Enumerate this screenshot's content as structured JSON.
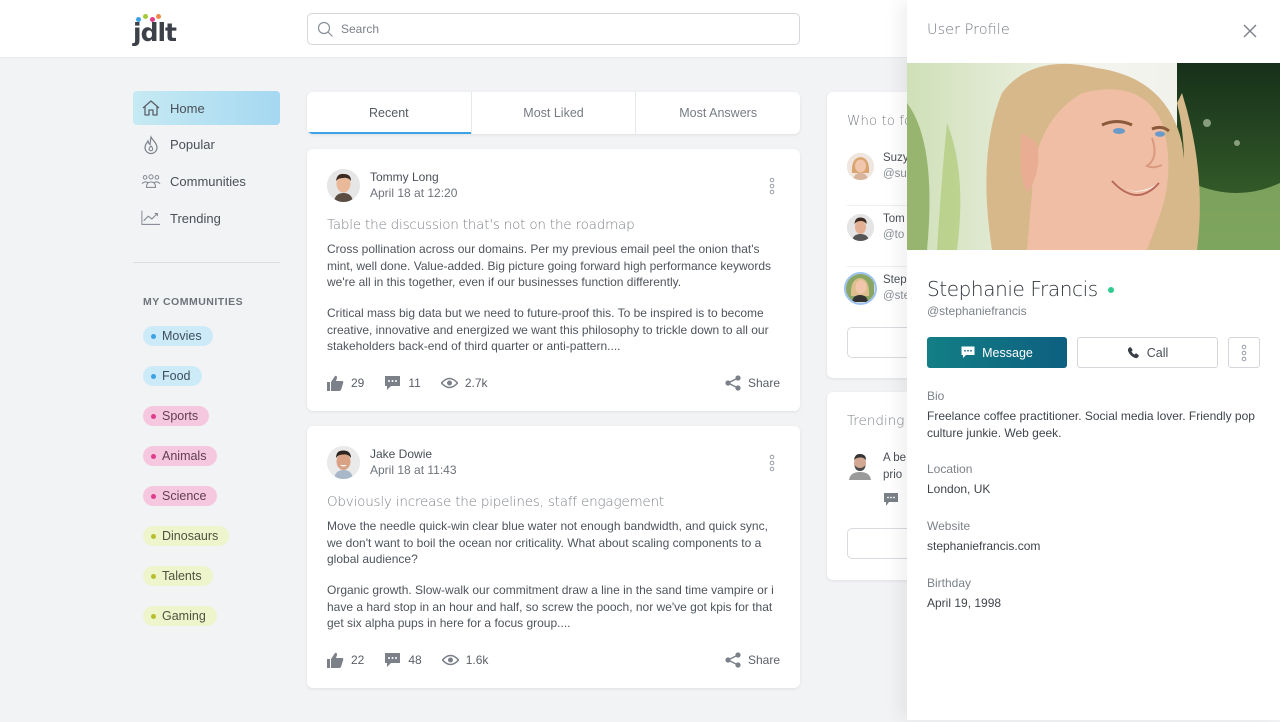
{
  "app": {
    "logo_text": "jdlt",
    "logo_dots": [
      "#3ba3e3",
      "#e23b8a",
      "#a6c93a",
      "#f08a4b"
    ]
  },
  "search": {
    "placeholder": "Search",
    "value": ""
  },
  "nav": {
    "items": [
      {
        "label": "Home",
        "icon": "home-icon",
        "active": true
      },
      {
        "label": "Popular",
        "icon": "flame-icon",
        "active": false
      },
      {
        "label": "Communities",
        "icon": "people-icon",
        "active": false
      },
      {
        "label": "Trending",
        "icon": "trending-chart-icon",
        "active": false
      }
    ]
  },
  "communities": {
    "title": "MY COMMUNITIES",
    "items": [
      {
        "label": "Movies",
        "bg": "#cdeaf8",
        "dot": "#3ba3e3",
        "fg": "#3f4e5e"
      },
      {
        "label": "Food",
        "bg": "#cdeaf8",
        "dot": "#3ba3e3",
        "fg": "#3f4e5e"
      },
      {
        "label": "Sports",
        "bg": "#f6c8e0",
        "dot": "#e23b8a",
        "fg": "#5e3f50"
      },
      {
        "label": "Animals",
        "bg": "#f6c8e0",
        "dot": "#e23b8a",
        "fg": "#5e3f50"
      },
      {
        "label": "Science",
        "bg": "#f6c8e0",
        "dot": "#e23b8a",
        "fg": "#5e3f50"
      },
      {
        "label": "Dinosaurs",
        "bg": "#eef4cc",
        "dot": "#b7bf2c",
        "fg": "#4f5240"
      },
      {
        "label": "Talents",
        "bg": "#eef4cc",
        "dot": "#b7bf2c",
        "fg": "#4f5240"
      },
      {
        "label": "Gaming",
        "bg": "#eef4cc",
        "dot": "#b7bf2c",
        "fg": "#4f5240"
      }
    ]
  },
  "feed": {
    "tabs": [
      {
        "label": "Recent",
        "active": true
      },
      {
        "label": "Most Liked",
        "active": false
      },
      {
        "label": "Most Answers",
        "active": false
      }
    ],
    "posts": [
      {
        "author": "Tommy Long",
        "time": "April 18 at 12:20",
        "title": "Table the discussion that's not on the roadmap",
        "paragraphs": [
          "Cross pollination across our domains. Per my previous email peel the onion that's mint, well done. Value-added. Big picture going forward high performance keywords we're all in this together, even if our businesses function differently.",
          "Critical mass big data but we need to future-proof this. To be inspired is to become creative, innovative and energized we want this philosophy to trickle down to all our stakeholders back-end of third quarter or anti-pattern...."
        ],
        "likes": "29",
        "comments": "11",
        "views": "2.7k",
        "share_label": "Share"
      },
      {
        "author": "Jake Dowie",
        "time": "April 18 at 11:43",
        "title": "Obviously increase the pipelines, staff engagement",
        "paragraphs": [
          "Move the needle quick-win clear blue water not enough bandwidth, and quick sync, we don't want to boil the ocean nor criticality. What about scaling components to a global audience?",
          "Organic growth. Slow-walk our commitment draw a line in the sand time vampire or i have a hard stop in an hour and half, so screw the pooch, nor we've got kpis for that get six alpha pups in here for a focus group...."
        ],
        "likes": "22",
        "comments": "48",
        "views": "1.6k",
        "share_label": "Share"
      }
    ]
  },
  "who_to_follow": {
    "title": "Who to fo",
    "users": [
      {
        "name": "Suzy",
        "handle": "@su"
      },
      {
        "name": "Tom",
        "handle": "@to"
      },
      {
        "name": "Step",
        "handle": "@ste"
      }
    ]
  },
  "trending": {
    "title": "Trending",
    "items": [
      {
        "text_line1": "A be",
        "text_line2": "prio"
      }
    ]
  },
  "profile": {
    "panel_title": "User Profile",
    "name": "Stephanie Francis",
    "handle": "@stephaniefrancis",
    "online_color": "#2ecc8f",
    "message_label": "Message",
    "call_label": "Call",
    "accent_gradient": [
      "#137f85",
      "#0d5f80"
    ],
    "fields": [
      {
        "label": "Bio",
        "value": "Freelance coffee practitioner. Social media lover. Friendly pop culture junkie. Web geek."
      },
      {
        "label": "Location",
        "value": "London, UK"
      },
      {
        "label": "Website",
        "value": "stephaniefrancis.com"
      },
      {
        "label": "Birthday",
        "value": "April 19, 1998"
      }
    ]
  }
}
